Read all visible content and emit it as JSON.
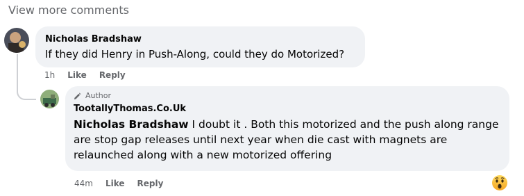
{
  "view_more": "View more comments",
  "comments": [
    {
      "author": "Nicholas Bradshaw",
      "text": "If they did Henry in Push-Along, could they do Motorized?",
      "time": "1h",
      "like_label": "Like",
      "reply_label": "Reply"
    },
    {
      "badge": "Author",
      "author": "TootallyThomas.Co.Uk",
      "mention": "Nicholas Bradshaw",
      "text": " I doubt it . Both this motorized and the push along range are stop gap releases until next year when die cast with magnets are relaunched along with a new motorized offering",
      "time": "44m",
      "like_label": "Like",
      "reply_label": "Reply",
      "reaction_icon": "wow-emoji-icon"
    }
  ],
  "colors": {
    "bubble": "#f0f2f5",
    "meta_text": "#65676b",
    "thread_line": "#ced0d4"
  }
}
